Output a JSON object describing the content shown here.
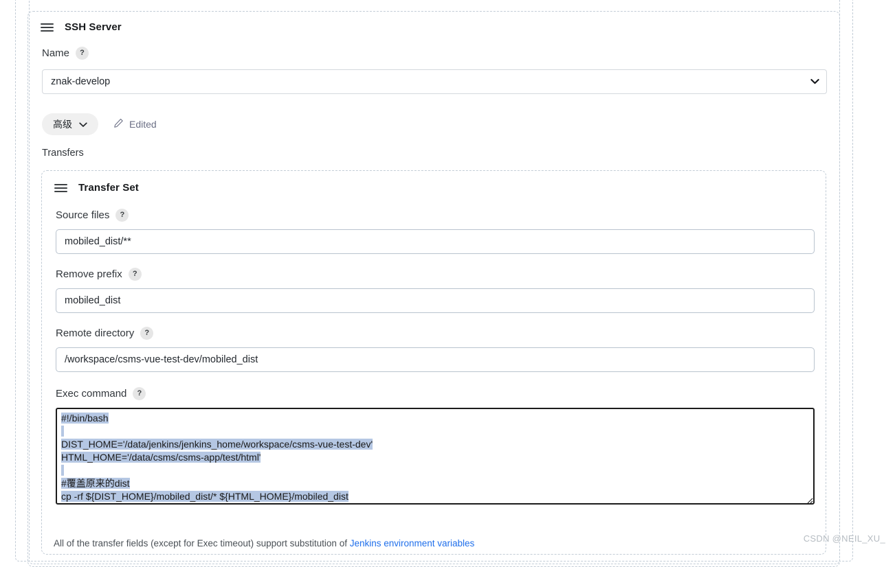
{
  "panels": {
    "ssh_server": {
      "title": "SSH Server",
      "drag_handle_icon": "hamburger-drag-icon",
      "name_field": {
        "label": "Name",
        "help": "?",
        "value": "znak-develop",
        "chevron_icon": "chevron-down-icon"
      },
      "advanced_button": {
        "label": "高级",
        "chevron_icon": "chevron-down-icon"
      },
      "edited_chip": {
        "label": "Edited",
        "icon": "pencil-edit-icon"
      },
      "transfers_label": "Transfers"
    },
    "transfer_set": {
      "title": "Transfer Set",
      "drag_handle_icon": "hamburger-drag-icon",
      "fields": [
        {
          "label": "Source files",
          "help": "?",
          "value": "mobiled_dist/**"
        },
        {
          "label": "Remove prefix",
          "help": "?",
          "value": "mobiled_dist"
        },
        {
          "label": "Remote directory",
          "help": "?",
          "value": "/workspace/csms-vue-test-dev/mobiled_dist"
        }
      ],
      "exec_command": {
        "label": "Exec command",
        "help": "?",
        "lines": [
          "#!/bin/bash",
          "",
          "DIST_HOME='/data/jenkins/jenkins_home/workspace/csms-vue-test-dev'",
          "HTML_HOME='/data/csms/csms-app/test/html'",
          "",
          "#覆盖原来的dist",
          "cp -rf ${DIST_HOME}/mobiled_dist/* ${HTML_HOME}/mobiled_dist"
        ],
        "selected": true,
        "selection_color": "#b5c7e3"
      }
    }
  },
  "footer": {
    "text_before": "All of the transfer fields (except for Exec timeout) support substitution of ",
    "link_text": "Jenkins environment variables",
    "link_color": "#1f6feb"
  },
  "watermark": {
    "text": "CSDN @NEIL_XU_"
  }
}
